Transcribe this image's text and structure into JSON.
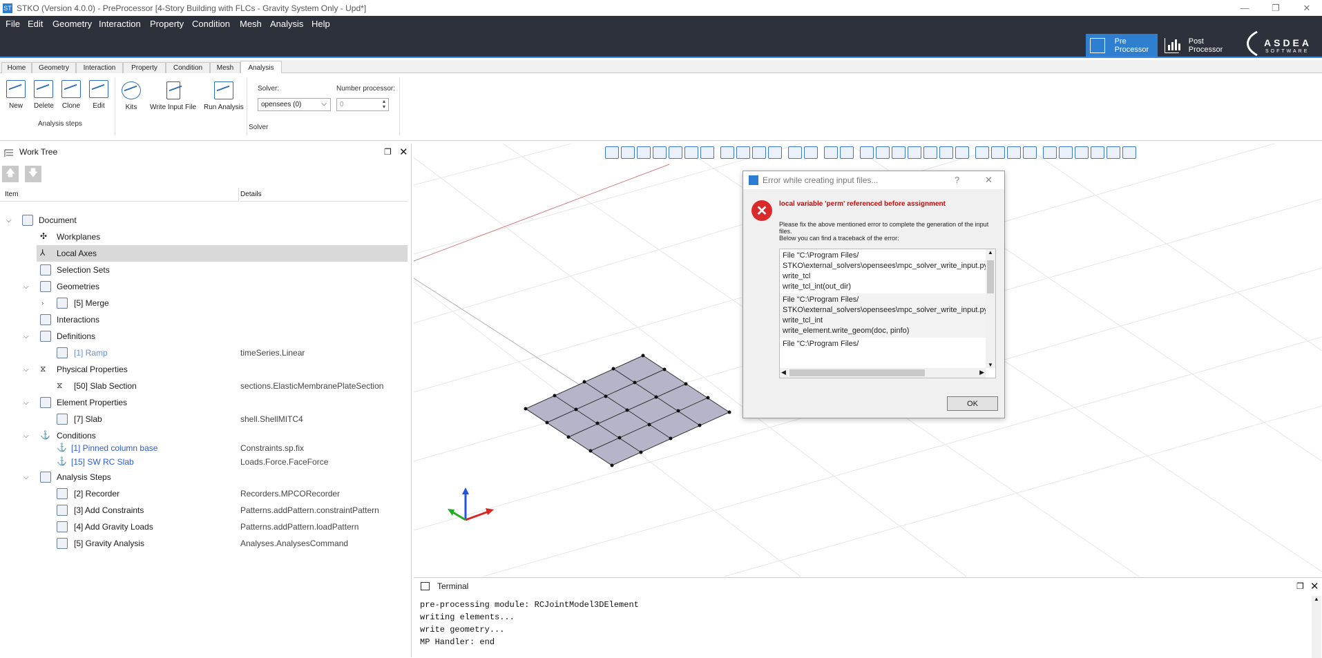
{
  "window": {
    "title": "STKO (Version 4.0.0) - PreProcessor [4-Story Building with FLCs - Gravity System Only - Upd*]",
    "minimize": "—",
    "restore": "❐",
    "close": "✕",
    "app_icon": "ST"
  },
  "menu": [
    "File",
    "Edit",
    "Geometry",
    "Interaction",
    "Property",
    "Condition",
    "Mesh",
    "Analysis",
    "Help"
  ],
  "modes": {
    "pre": "Pre Processor",
    "post": "Post Processor"
  },
  "logo": {
    "main": "ASDEA",
    "sub": "SOFTWARE"
  },
  "tabs": [
    "Home",
    "Geometry",
    "Interaction",
    "Property",
    "Condition",
    "Mesh",
    "Analysis"
  ],
  "active_tab": "Analysis",
  "ribbon": {
    "analysis_steps": {
      "new": "New",
      "delete": "Delete",
      "clone": "Clone",
      "edit": "Edit",
      "group": "Analysis steps"
    },
    "kits": "Kits",
    "write_input": "Write Input File",
    "run": "Run Analysis",
    "solver_label": "Solver:",
    "solver_value": "opensees (0)",
    "nproc_label": "Number processor:",
    "nproc_value": "0",
    "solver_group": "Solver"
  },
  "worktree": {
    "title": "Work Tree",
    "col_item": "Item",
    "col_details": "Details",
    "up": "🡅",
    "down": "🡇",
    "rows": [
      {
        "label": "Document",
        "details": ""
      },
      {
        "label": "Workplanes",
        "details": ""
      },
      {
        "label": "Local Axes",
        "details": ""
      },
      {
        "label": "Selection Sets",
        "details": ""
      },
      {
        "label": "Geometries",
        "details": ""
      },
      {
        "label": "[5] Merge",
        "details": ""
      },
      {
        "label": "Interactions",
        "details": ""
      },
      {
        "label": "Definitions",
        "details": ""
      },
      {
        "label": "[1] Ramp",
        "details": "timeSeries.Linear"
      },
      {
        "label": "Physical Properties",
        "details": ""
      },
      {
        "label": "[50] Slab Section",
        "details": "sections.ElasticMembranePlateSection"
      },
      {
        "label": "Element Properties",
        "details": ""
      },
      {
        "label": "[7] Slab",
        "details": "shell.ShellMITC4"
      },
      {
        "label": "Conditions",
        "details": ""
      },
      {
        "label": "[1] Pinned column base",
        "details": "Constraints.sp.fix"
      },
      {
        "label": "[15] SW RC Slab",
        "details": "Loads.Force.FaceForce"
      },
      {
        "label": "Analysis Steps",
        "details": ""
      },
      {
        "label": "[2] Recorder",
        "details": "Recorders.MPCORecorder"
      },
      {
        "label": "[3] Add Constraints",
        "details": "Patterns.addPattern.constraintPattern"
      },
      {
        "label": "[4] Add Gravity Loads",
        "details": "Patterns.addPattern.loadPattern"
      },
      {
        "label": "[5] Gravity Analysis",
        "details": "Analyses.AnalysesCommand"
      }
    ]
  },
  "dialog": {
    "title": "Error while creating input files...",
    "help": "?",
    "close": "✕",
    "icon": "✕",
    "message": "local variable 'perm' referenced before assignment",
    "desc1": "Please fix the above mentioned error to complete the generation of the input files.",
    "desc2": "Below you can find a traceback of the error:",
    "trace": [
      [
        "  File \"C:\\Program Files/",
        "STKO\\external_solvers\\opensees\\mpc_solver_write_input.py\"",
        "write_tcl",
        "    write_tcl_int(out_dir)"
      ],
      [
        "  File \"C:\\Program Files/",
        "STKO\\external_solvers\\opensees\\mpc_solver_write_input.py\"",
        "write_tcl_int",
        "    write_element.write_geom(doc, pinfo)"
      ],
      [
        "  File \"C:\\Program Files/"
      ]
    ],
    "ok": "OK"
  },
  "terminal": {
    "title": "Terminal",
    "lines": [
      "pre-processing module: RCJointModel3DElement",
      "writing elements...",
      "write geometry...",
      "MP Handler: end"
    ]
  },
  "colors": {
    "accent": "#2f7fd1",
    "menubar": "#2c313c",
    "error": "#e00000"
  }
}
